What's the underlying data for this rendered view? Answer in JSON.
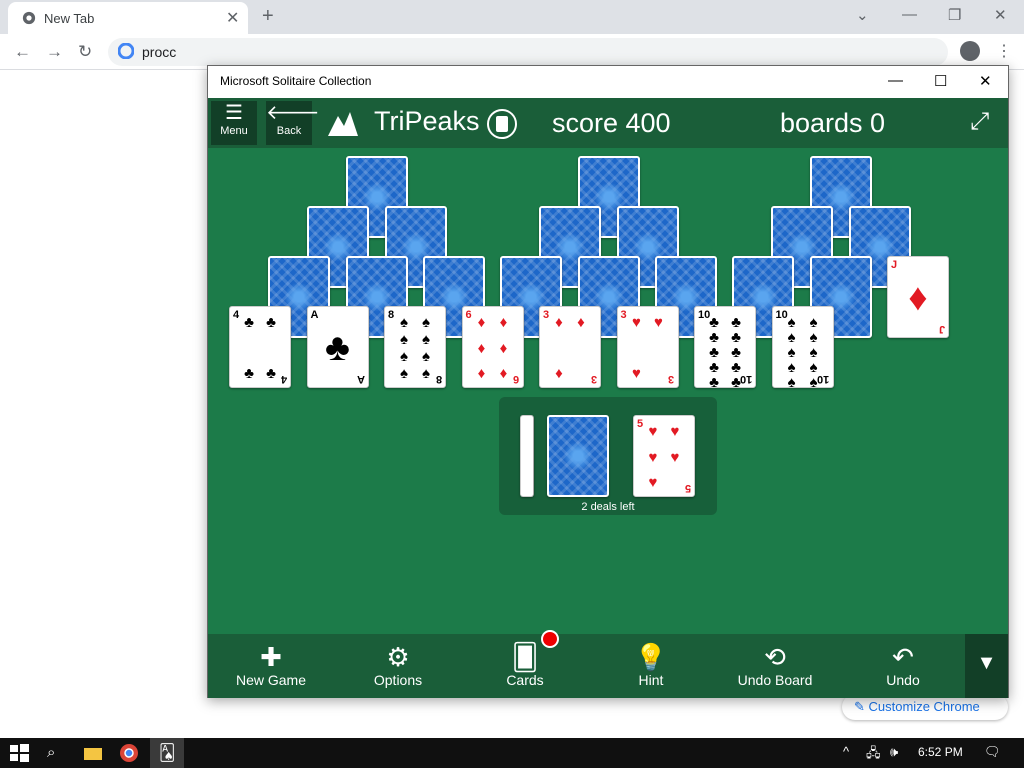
{
  "browser": {
    "tab_title": "New Tab",
    "omnibox_text": "procc",
    "customize_label": "Customize Chrome"
  },
  "window": {
    "title": "Microsoft Solitaire Collection"
  },
  "game": {
    "menu_label": "Menu",
    "back_label": "Back",
    "name": "TriPeaks",
    "score_text": "score 400",
    "boards_text": "boards 0",
    "deals_left": "2 deals left"
  },
  "tableau_row": [
    {
      "rank": "4",
      "suit": "♣",
      "color": "black"
    },
    {
      "rank": "A",
      "suit": "♣",
      "color": "black"
    },
    {
      "rank": "8",
      "suit": "♠",
      "color": "black"
    },
    {
      "rank": "6",
      "suit": "♦",
      "color": "red"
    },
    {
      "rank": "3",
      "suit": "♦",
      "color": "red"
    },
    {
      "rank": "3",
      "suit": "♥",
      "color": "red"
    },
    {
      "rank": "10",
      "suit": "♣",
      "color": "black"
    },
    {
      "rank": "10",
      "suit": "♠",
      "color": "black"
    }
  ],
  "exposed_high": {
    "rank": "J",
    "suit": "♦",
    "color": "red"
  },
  "waste_card": {
    "rank": "5",
    "suit": "♥",
    "color": "red"
  },
  "toolbar": {
    "new_game": "New Game",
    "options": "Options",
    "cards": "Cards",
    "hint": "Hint",
    "undo_board": "Undo Board",
    "undo": "Undo"
  },
  "taskbar": {
    "time": "6:52 PM"
  },
  "colors": {
    "felt": "#1c7b49",
    "bar": "#1a5e39",
    "card_back": "#1d67c9",
    "red_suit": "#e21a23"
  }
}
